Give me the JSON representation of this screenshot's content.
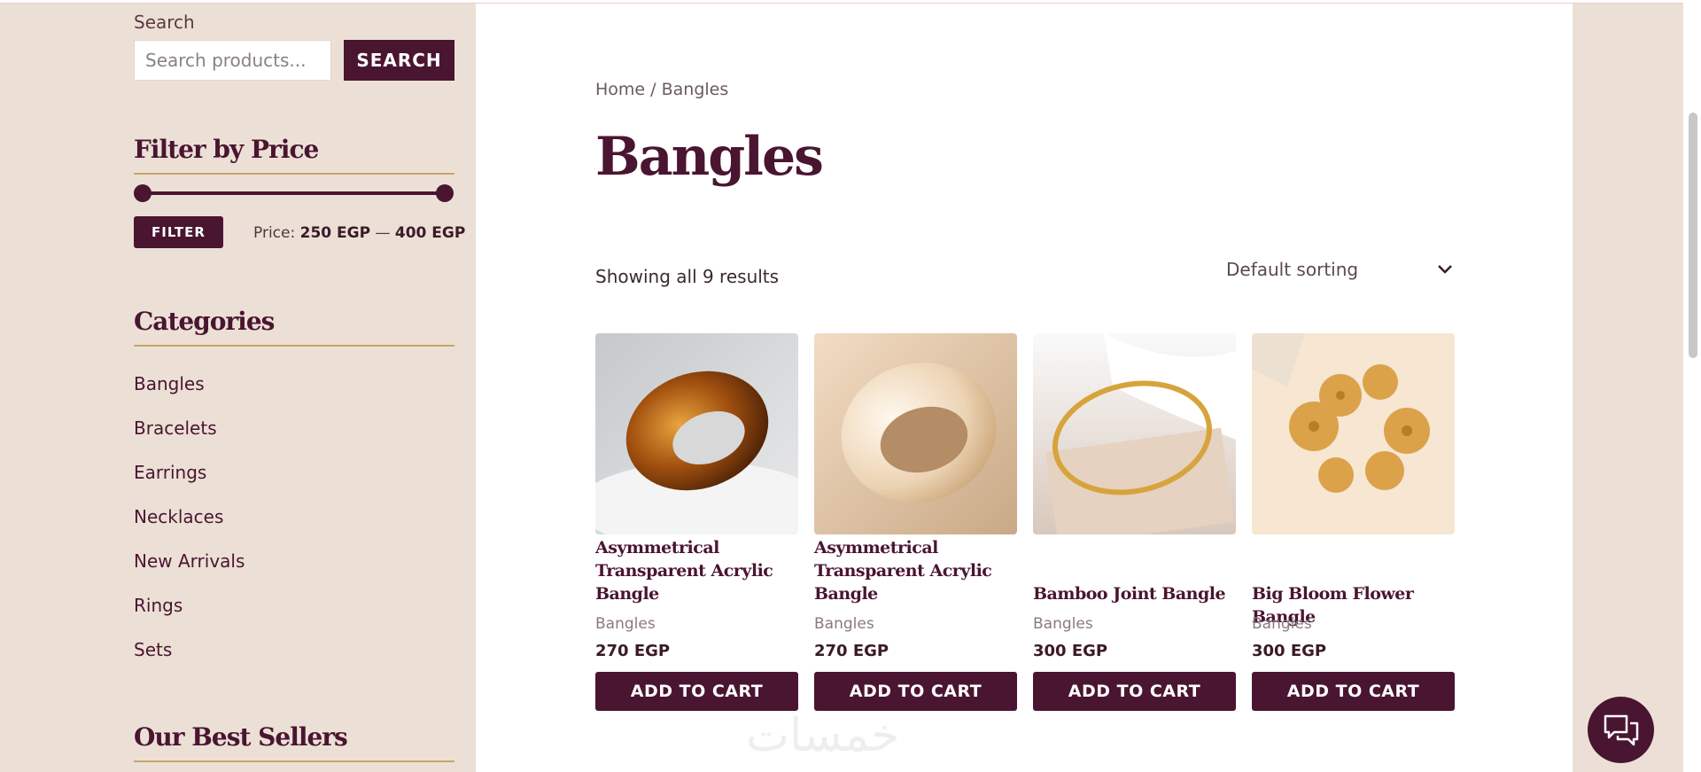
{
  "sidebar": {
    "search": {
      "label": "Search",
      "placeholder": "Search products...",
      "button": "SEARCH"
    },
    "price_filter": {
      "title": "Filter by Price",
      "button": "FILTER",
      "price_label": "Price:",
      "min": "250 EGP",
      "separator": "—",
      "max": "400 EGP",
      "range_min_fraction": 0,
      "range_max_fraction": 1
    },
    "categories": {
      "title": "Categories",
      "items": [
        "Bangles",
        "Bracelets",
        "Earrings",
        "Necklaces",
        "New Arrivals",
        "Rings",
        "Sets"
      ]
    },
    "best_sellers": {
      "title": "Our Best Sellers"
    }
  },
  "main": {
    "breadcrumb": {
      "home": "Home",
      "separator": "/",
      "current": "Bangles"
    },
    "title": "Bangles",
    "result_count": "Showing all 9 results",
    "sorting": "Default sorting",
    "products": [
      {
        "name": "Asymmetrical Transparent Acrylic Bangle",
        "category": "Bangles",
        "price": "270 EGP",
        "cart": "ADD TO CART"
      },
      {
        "name": "Asymmetrical Transparent Acrylic Bangle",
        "category": "Bangles",
        "price": "270 EGP",
        "cart": "ADD TO CART"
      },
      {
        "name": "Bamboo Joint Bangle",
        "category": "Bangles",
        "price": "300 EGP",
        "cart": "ADD TO CART"
      },
      {
        "name": "Big Bloom Flower Bangle",
        "category": "Bangles",
        "price": "300 EGP",
        "cart": "ADD TO CART"
      }
    ]
  },
  "watermark": "خمسات",
  "colors": {
    "brand": "#4a1530",
    "sidebar_bg": "#ece0d6",
    "accent_line": "#c9a36a"
  },
  "icons": {
    "sort": "chevron-down-icon",
    "chat": "chat-bubbles-icon"
  }
}
